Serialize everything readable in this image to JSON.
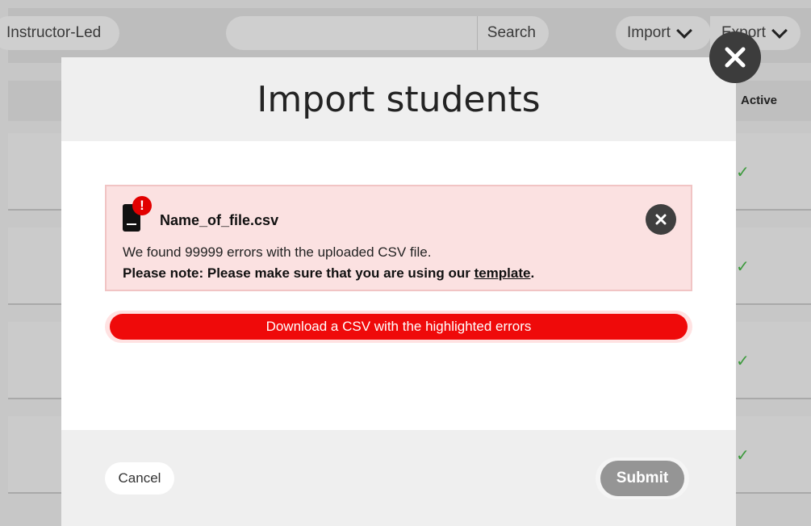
{
  "background": {
    "toolbar": {
      "instructor_led_label": "Instructor-Led",
      "search_label": "Search",
      "import_label": "Import",
      "export_label": "Export"
    },
    "table": {
      "active_header": "Active",
      "rows": [
        {
          "active": "✓"
        },
        {
          "active": "✓"
        },
        {
          "active": "✓"
        },
        {
          "active": "✓"
        }
      ]
    }
  },
  "modal": {
    "title": "Import students",
    "close_icon": "close-icon",
    "alert": {
      "file_icon": "file-error-icon",
      "filename": "Name_of_file.csv",
      "message": "We found 99999 errors with the uploaded CSV file.",
      "note_prefix": "Please note:  Please make sure that you are using our ",
      "note_link": "template",
      "note_suffix": ".",
      "dismiss_icon": "close-icon"
    },
    "download_button": "Download a CSV with the highlighted errors",
    "cancel_button": "Cancel",
    "submit_button": "Submit"
  },
  "colors": {
    "error_red": "#ef0a0a",
    "alert_background": "#fbe1e1",
    "active_check": "#3c9a3c",
    "submit_disabled": "#959595"
  }
}
